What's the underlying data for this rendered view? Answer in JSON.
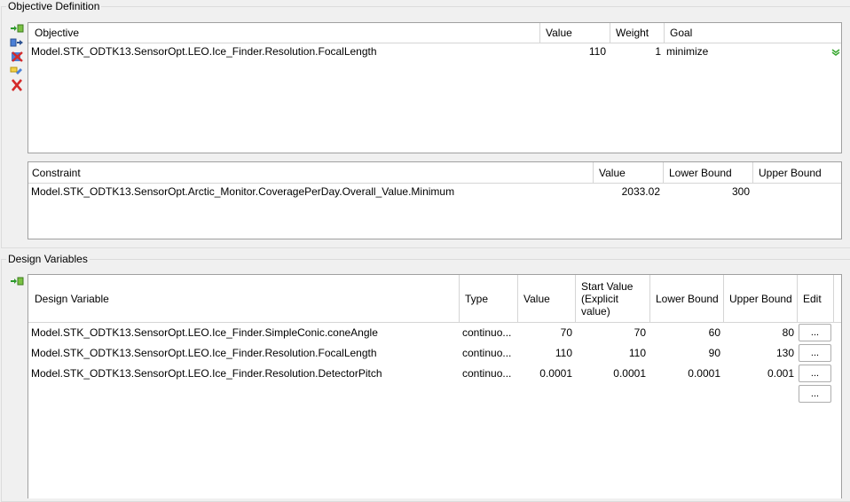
{
  "objective_section": {
    "title": "Objective Definition",
    "objectives": {
      "headers": {
        "objective": "Objective",
        "value": "Value",
        "weight": "Weight",
        "goal": "Goal"
      },
      "rows": [
        {
          "objective": "Model.STK_ODTK13.SensorOpt.LEO.Ice_Finder.Resolution.FocalLength",
          "value": "110",
          "weight": "1",
          "goal": "minimize"
        }
      ]
    },
    "constraints": {
      "headers": {
        "constraint": "Constraint",
        "value": "Value",
        "lower_bound": "Lower Bound",
        "upper_bound": "Upper Bound"
      },
      "rows": [
        {
          "constraint": "Model.STK_ODTK13.SensorOpt.Arctic_Monitor.CoveragePerDay.Overall_Value.Minimum",
          "value": "2033.02",
          "lower_bound": "300",
          "upper_bound": ""
        }
      ]
    },
    "toolbar_icons": [
      "add-objective-icon",
      "move-objective-icon",
      "remove-objective-icon",
      "edit-objective-icon",
      "delete-objective-icon"
    ]
  },
  "design_section": {
    "title": "Design Variables",
    "headers": {
      "design_variable": "Design Variable",
      "type": "Type",
      "value": "Value",
      "start_value": "Start Value (Explicit value)",
      "lower_bound": "Lower Bound",
      "upper_bound": "Upper Bound",
      "edit": "Edit"
    },
    "rows": [
      {
        "design_variable": "Model.STK_ODTK13.SensorOpt.LEO.Ice_Finder.SimpleConic.coneAngle",
        "type": "continuo...",
        "value": "70",
        "start_value": "70",
        "lower_bound": "60",
        "upper_bound": "80",
        "edit": "..."
      },
      {
        "design_variable": "Model.STK_ODTK13.SensorOpt.LEO.Ice_Finder.Resolution.FocalLength",
        "type": "continuo...",
        "value": "110",
        "start_value": "110",
        "lower_bound": "90",
        "upper_bound": "130",
        "edit": "..."
      },
      {
        "design_variable": "Model.STK_ODTK13.SensorOpt.LEO.Ice_Finder.Resolution.DetectorPitch",
        "type": "continuo...",
        "value": "0.0001",
        "start_value": "0.0001",
        "lower_bound": "0.0001",
        "upper_bound": "0.001",
        "edit": "..."
      }
    ],
    "empty_row_edit": "...",
    "toolbar_icons": [
      "add-design-variable-icon"
    ]
  },
  "colors": {
    "goal_arrow": "#3aa832",
    "grid_border": "#a0a0a0"
  }
}
